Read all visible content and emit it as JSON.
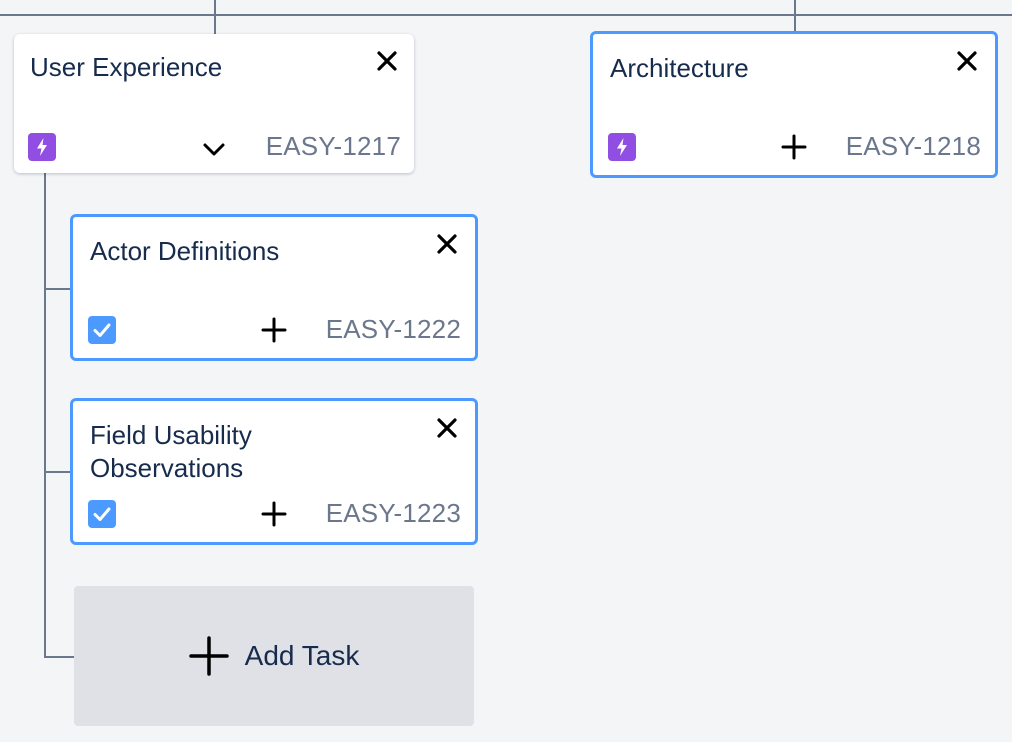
{
  "cards": {
    "user_experience": {
      "title": "User Experience",
      "key": "EASY-1217",
      "type_icon": "epic-lightning-icon",
      "action_icon": "chevron-down-icon"
    },
    "architecture": {
      "title": "Architecture",
      "key": "EASY-1218",
      "type_icon": "epic-lightning-icon",
      "action_icon": "plus-icon"
    },
    "actor_definitions": {
      "title": "Actor Definitions",
      "key": "EASY-1222",
      "type_icon": "task-checkbox-icon",
      "action_icon": "plus-icon"
    },
    "field_usability": {
      "title": "Field Usability Observations",
      "key": "EASY-1223",
      "type_icon": "task-checkbox-icon",
      "action_icon": "plus-icon"
    }
  },
  "add_task": {
    "label": "Add Task",
    "icon": "plus-icon"
  },
  "colors": {
    "background": "#f4f5f7",
    "card": "#ffffff",
    "selected_border": "#4c9aff",
    "epic": "#904ee2",
    "task": "#4c9aff",
    "key_text": "#6b778c",
    "title_text": "#172b4d",
    "add_task_bg": "#dfe1e6"
  }
}
